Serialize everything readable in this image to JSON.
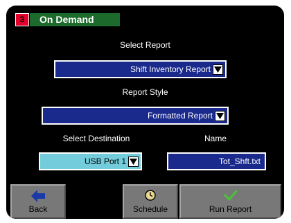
{
  "header": {
    "badge": "3",
    "title": "On Demand"
  },
  "select_report": {
    "label": "Select Report",
    "value": "Shift Inventory Report"
  },
  "report_style": {
    "label": "Report Style",
    "value": "Formatted Report"
  },
  "destination": {
    "label": "Select Destination",
    "value": "USB Port 1"
  },
  "name": {
    "label": "Name",
    "value": "Tot_Shft.txt"
  },
  "buttons": {
    "back": "Back",
    "schedule": "Schedule",
    "run": "Run Report"
  },
  "colors": {
    "screen": "#000000",
    "field_blue": "#1a2a8c",
    "field_cyan": "#72ccdb",
    "title_green": "#1c6a2c",
    "badge_red": "#e3002b",
    "button_gray": "#787878",
    "back_arrow": "#1a3aa8",
    "check_green": "#4cbf3a"
  },
  "icons": {
    "back": "left-arrow-icon",
    "schedule": "clock-icon",
    "run": "checkmark-icon",
    "dropdown": "chevron-down-icon"
  }
}
